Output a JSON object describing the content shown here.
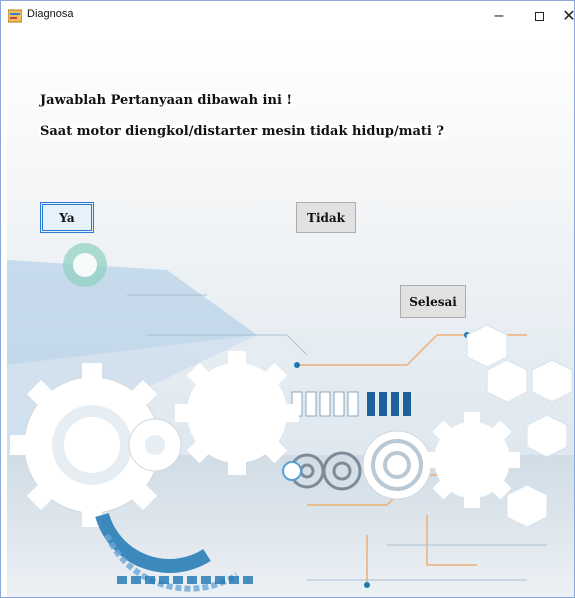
{
  "window": {
    "title": "Diagnosa",
    "controls": {
      "minimize": "–",
      "close": "✕"
    }
  },
  "content": {
    "instruction": "Jawablah Pertanyaan dibawah ini !",
    "question": "Saat motor diengkol/distarter mesin tidak hidup/mati ?"
  },
  "buttons": {
    "yes": "Ya",
    "no": "Tidak",
    "finish": "Selesai"
  },
  "colors": {
    "accent": "#2a7ad5",
    "gear": "#ffffff",
    "art_blue": "#1f78b4",
    "art_orange": "#f2b37a"
  },
  "icons": {
    "app": "form-icon",
    "minimize": "minimize-icon",
    "maximize": "maximize-icon",
    "close": "close-icon"
  }
}
